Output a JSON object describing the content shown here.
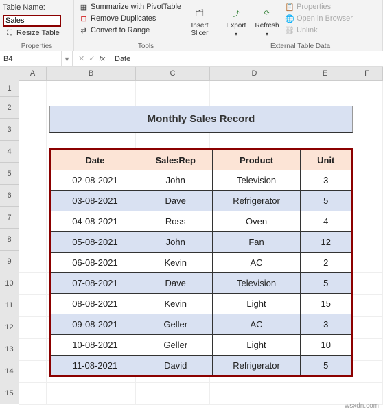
{
  "ribbon": {
    "table_name_label": "Table Name:",
    "table_name_value": "Sales",
    "resize_table": "Resize Table",
    "group_properties": "Properties",
    "summarize": "Summarize with PivotTable",
    "remove_dup": "Remove Duplicates",
    "convert_range": "Convert to Range",
    "insert_slicer": "Insert Slicer",
    "group_tools": "Tools",
    "export": "Export",
    "refresh": "Refresh",
    "properties_btn": "Properties",
    "open_browser": "Open in Browser",
    "unlink": "Unlink",
    "group_external": "External Table Data"
  },
  "bar": {
    "namebox": "B4",
    "formula": "Date"
  },
  "columns": [
    "A",
    "B",
    "C",
    "D",
    "E",
    "F"
  ],
  "rows": [
    "1",
    "2",
    "3",
    "4",
    "5",
    "6",
    "7",
    "8",
    "9",
    "10",
    "11",
    "12",
    "13",
    "14",
    "15"
  ],
  "title": "Monthly Sales Record",
  "table": {
    "headers": [
      "Date",
      "SalesRep",
      "Product",
      "Unit"
    ],
    "data": [
      [
        "02-08-2021",
        "John",
        "Television",
        "3"
      ],
      [
        "03-08-2021",
        "Dave",
        "Refrigerator",
        "5"
      ],
      [
        "04-08-2021",
        "Ross",
        "Oven",
        "4"
      ],
      [
        "05-08-2021",
        "John",
        "Fan",
        "12"
      ],
      [
        "06-08-2021",
        "Kevin",
        "AC",
        "2"
      ],
      [
        "07-08-2021",
        "Dave",
        "Television",
        "5"
      ],
      [
        "08-08-2021",
        "Kevin",
        "Light",
        "15"
      ],
      [
        "09-08-2021",
        "Geller",
        "AC",
        "3"
      ],
      [
        "10-08-2021",
        "Geller",
        "Light",
        "10"
      ],
      [
        "11-08-2021",
        "David",
        "Refrigerator",
        "5"
      ]
    ]
  },
  "chart_data": {
    "type": "table",
    "title": "Monthly Sales Record",
    "columns": [
      "Date",
      "SalesRep",
      "Product",
      "Unit"
    ],
    "rows": [
      {
        "Date": "02-08-2021",
        "SalesRep": "John",
        "Product": "Television",
        "Unit": 3
      },
      {
        "Date": "03-08-2021",
        "SalesRep": "Dave",
        "Product": "Refrigerator",
        "Unit": 5
      },
      {
        "Date": "04-08-2021",
        "SalesRep": "Ross",
        "Product": "Oven",
        "Unit": 4
      },
      {
        "Date": "05-08-2021",
        "SalesRep": "John",
        "Product": "Fan",
        "Unit": 12
      },
      {
        "Date": "06-08-2021",
        "SalesRep": "Kevin",
        "Product": "AC",
        "Unit": 2
      },
      {
        "Date": "07-08-2021",
        "SalesRep": "Dave",
        "Product": "Television",
        "Unit": 5
      },
      {
        "Date": "08-08-2021",
        "SalesRep": "Kevin",
        "Product": "Light",
        "Unit": 15
      },
      {
        "Date": "09-08-2021",
        "SalesRep": "Geller",
        "Product": "AC",
        "Unit": 3
      },
      {
        "Date": "10-08-2021",
        "SalesRep": "Geller",
        "Product": "Light",
        "Unit": 10
      },
      {
        "Date": "11-08-2021",
        "SalesRep": "David",
        "Product": "Refrigerator",
        "Unit": 5
      }
    ]
  },
  "watermark": "wsxdn.com"
}
